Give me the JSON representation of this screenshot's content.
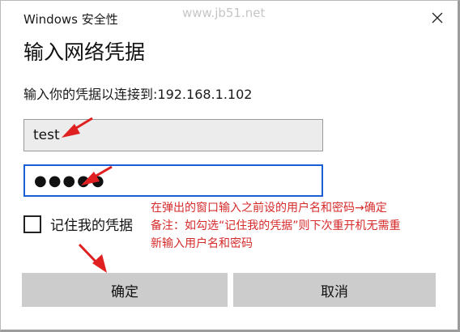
{
  "window": {
    "title": "Windows 安全性",
    "watermark": "www.jb51.net"
  },
  "dialog": {
    "heading": "输入网络凭据",
    "subtitle": "输入你的凭据以连接到:192.168.1.102"
  },
  "fields": {
    "username_value": "test",
    "password_masked": "●●●●●"
  },
  "remember": {
    "label": "记住我的凭据",
    "checked": false
  },
  "annotation": {
    "line1": "在弹出的窗口输入之前设的用户名和密码→确定",
    "line2": "备注：如勾选“记住我的凭据”则下次重开机无需重",
    "line3": "新输入用户名和密码",
    "color": "#d62b2b"
  },
  "buttons": {
    "ok_label": "确定",
    "cancel_label": "取消"
  },
  "icons": {
    "close": "close-icon",
    "arrow": "red-arrow-icon"
  }
}
